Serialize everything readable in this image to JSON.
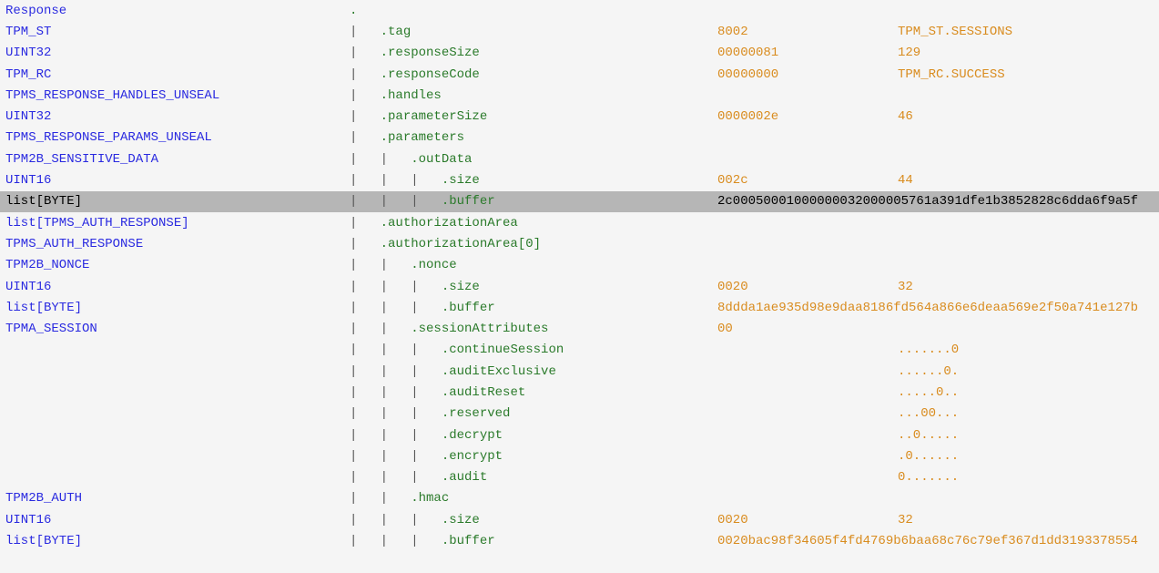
{
  "rows": [
    {
      "type": "Response",
      "tree": "",
      "field": ".",
      "hex": "",
      "dec": "",
      "hl": false
    },
    {
      "type": "TPM_ST",
      "tree": "|   ",
      "field": ".tag",
      "hex": "8002",
      "dec": "TPM_ST.SESSIONS",
      "hl": false
    },
    {
      "type": "UINT32",
      "tree": "|   ",
      "field": ".responseSize",
      "hex": "00000081",
      "dec": "129",
      "hl": false
    },
    {
      "type": "TPM_RC",
      "tree": "|   ",
      "field": ".responseCode",
      "hex": "00000000",
      "dec": "TPM_RC.SUCCESS",
      "hl": false
    },
    {
      "type": "TPMS_RESPONSE_HANDLES_UNSEAL",
      "tree": "|   ",
      "field": ".handles",
      "hex": "",
      "dec": "",
      "hl": false
    },
    {
      "type": "UINT32",
      "tree": "|   ",
      "field": ".parameterSize",
      "hex": "0000002e",
      "dec": "46",
      "hl": false
    },
    {
      "type": "TPMS_RESPONSE_PARAMS_UNSEAL",
      "tree": "|   ",
      "field": ".parameters",
      "hex": "",
      "dec": "",
      "hl": false
    },
    {
      "type": "TPM2B_SENSITIVE_DATA",
      "tree": "|   |   ",
      "field": ".outData",
      "hex": "",
      "dec": "",
      "hl": false
    },
    {
      "type": "UINT16",
      "tree": "|   |   |   ",
      "field": ".size",
      "hex": "002c",
      "dec": "44",
      "hl": false
    },
    {
      "type": "list[BYTE]",
      "tree": "|   |   |   ",
      "field": ".buffer",
      "hex": "2c00050001000000032000005761a391dfe1b3852828c6dda6f9a5f",
      "dec": "",
      "hl": true,
      "hexfull": true
    },
    {
      "type": "list[TPMS_AUTH_RESPONSE]",
      "tree": "|   ",
      "field": ".authorizationArea",
      "hex": "",
      "dec": "",
      "hl": false
    },
    {
      "type": "TPMS_AUTH_RESPONSE",
      "tree": "|   ",
      "field": ".authorizationArea[0]",
      "hex": "",
      "dec": "",
      "hl": false
    },
    {
      "type": "TPM2B_NONCE",
      "tree": "|   |   ",
      "field": ".nonce",
      "hex": "",
      "dec": "",
      "hl": false
    },
    {
      "type": "UINT16",
      "tree": "|   |   |   ",
      "field": ".size",
      "hex": "0020",
      "dec": "32",
      "hl": false
    },
    {
      "type": "list[BYTE]",
      "tree": "|   |   |   ",
      "field": ".buffer",
      "hex": "8ddda1ae935d98e9daa8186fd564a866e6deaa569e2f50a741e127b",
      "dec": "",
      "hl": false,
      "hexfull": true
    },
    {
      "type": "TPMA_SESSION",
      "tree": "|   |   ",
      "field": ".sessionAttributes",
      "hex": "00",
      "dec": "",
      "hl": false
    },
    {
      "type": "",
      "tree": "|   |   |   ",
      "field": ".continueSession",
      "hex": "",
      "dec": ".......0",
      "hl": false
    },
    {
      "type": "",
      "tree": "|   |   |   ",
      "field": ".auditExclusive",
      "hex": "",
      "dec": "......0.",
      "hl": false
    },
    {
      "type": "",
      "tree": "|   |   |   ",
      "field": ".auditReset",
      "hex": "",
      "dec": ".....0..",
      "hl": false
    },
    {
      "type": "",
      "tree": "|   |   |   ",
      "field": ".reserved",
      "hex": "",
      "dec": "...00...",
      "hl": false
    },
    {
      "type": "",
      "tree": "|   |   |   ",
      "field": ".decrypt",
      "hex": "",
      "dec": "..0.....",
      "hl": false
    },
    {
      "type": "",
      "tree": "|   |   |   ",
      "field": ".encrypt",
      "hex": "",
      "dec": ".0......",
      "hl": false
    },
    {
      "type": "",
      "tree": "|   |   |   ",
      "field": ".audit",
      "hex": "",
      "dec": "0.......",
      "hl": false
    },
    {
      "type": "TPM2B_AUTH",
      "tree": "|   |   ",
      "field": ".hmac",
      "hex": "",
      "dec": "",
      "hl": false
    },
    {
      "type": "UINT16",
      "tree": "|   |   |   ",
      "field": ".size",
      "hex": "0020",
      "dec": "32",
      "hl": false
    },
    {
      "type": "list[BYTE]",
      "tree": "|   |   |   ",
      "field": ".buffer",
      "hex": "0020bac98f34605f4fd4769b6baa68c76c79ef367d1dd3193378554",
      "dec": "",
      "hl": false,
      "hexfull": true
    }
  ]
}
